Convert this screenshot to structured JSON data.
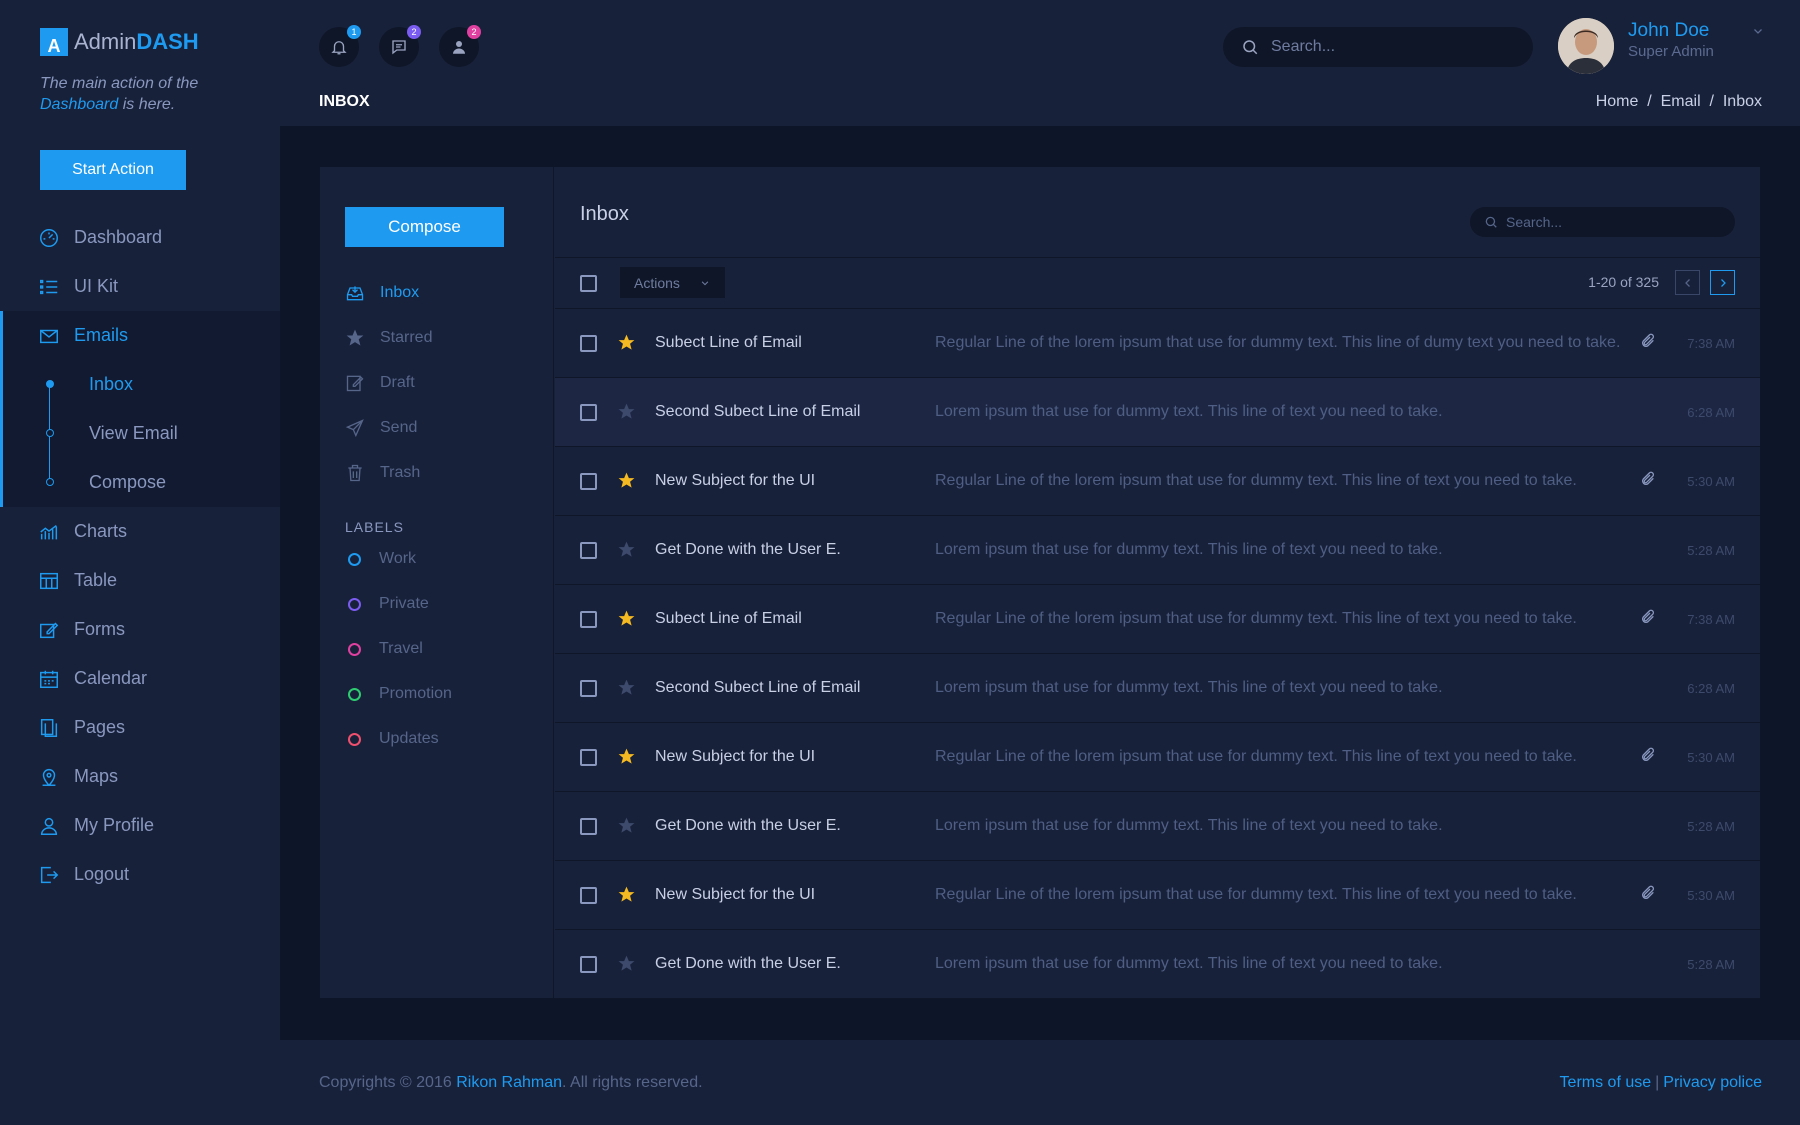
{
  "sidebar": {
    "logo_letter": "A",
    "logo_light": "Admin",
    "logo_bold": "DASH",
    "tagline_pre": "The main action of the ",
    "tagline_hl": "Dashboard",
    "tagline_post": " is here.",
    "start_action": "Start Action",
    "items": [
      {
        "label": "Dashboard",
        "icon": "dashboard-icon"
      },
      {
        "label": "UI Kit",
        "icon": "list-icon"
      },
      {
        "label": "Emails",
        "icon": "envelope-icon",
        "active": true,
        "children": [
          {
            "label": "Inbox",
            "active": true
          },
          {
            "label": "View Email"
          },
          {
            "label": "Compose"
          }
        ]
      },
      {
        "label": "Charts",
        "icon": "chart-icon"
      },
      {
        "label": "Table",
        "icon": "table-icon"
      },
      {
        "label": "Forms",
        "icon": "edit-icon"
      },
      {
        "label": "Calendar",
        "icon": "calendar-icon"
      },
      {
        "label": "Pages",
        "icon": "pages-icon"
      },
      {
        "label": "Maps",
        "icon": "map-pin-icon"
      },
      {
        "label": "My Profile",
        "icon": "user-icon"
      },
      {
        "label": "Logout",
        "icon": "logout-icon"
      }
    ]
  },
  "topbar": {
    "notifications": {
      "count": "1",
      "color": "#1e9bf0"
    },
    "messages": {
      "count": "2",
      "color": "#7b5cf0"
    },
    "users": {
      "count": "2",
      "color": "#e040a0"
    },
    "search_placeholder": "Search...",
    "user_name": "John Doe",
    "user_role": "Super Admin",
    "page_title": "INBOX",
    "breadcrumb": "Home  /  Email  /  Inbox"
  },
  "mail": {
    "compose": "Compose",
    "folders": [
      {
        "label": "Inbox",
        "icon": "inbox-icon",
        "active": true
      },
      {
        "label": "Starred",
        "icon": "star-icon"
      },
      {
        "label": "Draft",
        "icon": "draft-icon"
      },
      {
        "label": "Send",
        "icon": "send-icon"
      },
      {
        "label": "Trash",
        "icon": "trash-icon"
      }
    ],
    "labels_title": "LABELS",
    "labels": [
      {
        "label": "Work",
        "color": "#1e9bf0"
      },
      {
        "label": "Private",
        "color": "#7b5cf0"
      },
      {
        "label": "Travel",
        "color": "#e040a0"
      },
      {
        "label": "Promotion",
        "color": "#2ecc71"
      },
      {
        "label": "Updates",
        "color": "#f0506e"
      }
    ],
    "inbox_title": "Inbox",
    "search_placeholder": "Search...",
    "actions": "Actions",
    "page_info": "1-20 of 325",
    "rows": [
      {
        "starred": true,
        "subject": "Subect Line of Email",
        "preview": "Regular Line of the lorem ipsum that use for dummy text. This line of dumy text you need to take.",
        "attachment": true,
        "time": "7:38 AM"
      },
      {
        "starred": false,
        "subject": "Second Subect Line of Email",
        "preview": "Lorem ipsum that use for dummy text. This line of text you need to take.",
        "attachment": false,
        "time": "6:28 AM",
        "highlight": true
      },
      {
        "starred": true,
        "subject": "New Subject for the UI",
        "preview": "Regular Line of the lorem ipsum that use for dummy text. This line of text you need to take.",
        "attachment": true,
        "time": "5:30 AM"
      },
      {
        "starred": false,
        "subject": "Get Done with the User E.",
        "preview": "Lorem ipsum that use for dummy text. This line of text you need to take.",
        "attachment": false,
        "time": "5:28 AM"
      },
      {
        "starred": true,
        "subject": "Subect Line of Email",
        "preview": "Regular Line of the lorem ipsum that use for dummy text. This line of text you need to take.",
        "attachment": true,
        "time": "7:38 AM"
      },
      {
        "starred": false,
        "subject": "Second Subect Line of Email",
        "preview": "Lorem ipsum that use for dummy text. This line of text you need to take.",
        "attachment": false,
        "time": "6:28 AM"
      },
      {
        "starred": true,
        "subject": "New Subject for the UI",
        "preview": "Regular Line of the lorem ipsum that use for dummy text. This line of text you need to take.",
        "attachment": true,
        "time": "5:30 AM"
      },
      {
        "starred": false,
        "subject": "Get Done with the User E.",
        "preview": "Lorem ipsum that use for dummy text. This line of text you need to take.",
        "attachment": false,
        "time": "5:28 AM"
      },
      {
        "starred": true,
        "subject": "New Subject for the UI",
        "preview": "Regular Line of the lorem ipsum that use for dummy text. This line of text you need to take.",
        "attachment": true,
        "time": "5:30 AM"
      },
      {
        "starred": false,
        "subject": "Get Done with the User E.",
        "preview": "Lorem ipsum that use for dummy text. This line of text you need to take.",
        "attachment": false,
        "time": "5:28 AM"
      }
    ]
  },
  "footer": {
    "copy_pre": "Copyrights © 2016 ",
    "author": "Rikon Rahman",
    "copy_post": ". All rights reserved.",
    "terms": "Terms of use",
    "separator": "|",
    "privacy": "Privacy police"
  },
  "colors": {
    "accent": "#1e9bf0",
    "star_on": "#f5b921",
    "star_off": "#3d4a6c"
  }
}
